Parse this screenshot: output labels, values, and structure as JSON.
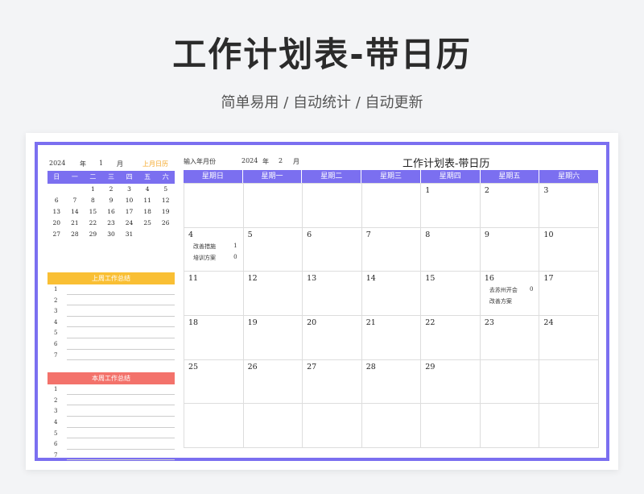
{
  "header": {
    "title": "工作计划表-带日历",
    "subtitle": "简单易用  /  自动统计  /  自动更新"
  },
  "mini": {
    "year": "2024",
    "year_unit": "年",
    "month": "1",
    "month_unit": "月",
    "prev_label": "上月日历",
    "weekdays": [
      "日",
      "一",
      "二",
      "三",
      "四",
      "五",
      "六"
    ],
    "days": [
      "",
      "",
      "1",
      "2",
      "3",
      "4",
      "5",
      "6",
      "7",
      "8",
      "9",
      "10",
      "11",
      "12",
      "13",
      "14",
      "15",
      "16",
      "17",
      "18",
      "19",
      "20",
      "21",
      "22",
      "23",
      "24",
      "25",
      "26",
      "27",
      "28",
      "29",
      "30",
      "31",
      "",
      "",
      ""
    ]
  },
  "last_week": {
    "label": "上周工作总结",
    "rows": [
      "1",
      "2",
      "3",
      "4",
      "5",
      "6",
      "7"
    ]
  },
  "this_week": {
    "label": "本周工作总结",
    "rows": [
      "1",
      "2",
      "3",
      "4",
      "5",
      "6",
      "7"
    ]
  },
  "calendar": {
    "input_label": "输入年月份",
    "year": "2024",
    "year_unit": "年",
    "month": "2",
    "month_unit": "月",
    "title": "工作计划表-带日历",
    "weekdays": [
      "星期日",
      "星期一",
      "星期二",
      "星期三",
      "星期四",
      "星期五",
      "星期六"
    ],
    "cells": [
      {
        "d": ""
      },
      {
        "d": ""
      },
      {
        "d": ""
      },
      {
        "d": ""
      },
      {
        "d": "1"
      },
      {
        "d": "2"
      },
      {
        "d": "3"
      },
      {
        "d": "4",
        "tasks": [
          {
            "t": "改善措施",
            "c": "1"
          },
          {
            "t": "培训方案",
            "c": "0"
          }
        ]
      },
      {
        "d": "5"
      },
      {
        "d": "6"
      },
      {
        "d": "7"
      },
      {
        "d": "8"
      },
      {
        "d": "9"
      },
      {
        "d": "10"
      },
      {
        "d": "11"
      },
      {
        "d": "12"
      },
      {
        "d": "13"
      },
      {
        "d": "14"
      },
      {
        "d": "15"
      },
      {
        "d": "16",
        "tasks": [
          {
            "t": "去苏州开会",
            "c": "0"
          },
          {
            "t": "改善方案",
            "c": ""
          }
        ]
      },
      {
        "d": "17"
      },
      {
        "d": "18"
      },
      {
        "d": "19"
      },
      {
        "d": "20"
      },
      {
        "d": "21"
      },
      {
        "d": "22"
      },
      {
        "d": "23"
      },
      {
        "d": "24"
      },
      {
        "d": "25"
      },
      {
        "d": "26"
      },
      {
        "d": "27"
      },
      {
        "d": "28"
      },
      {
        "d": "29"
      },
      {
        "d": ""
      },
      {
        "d": ""
      },
      {
        "d": ""
      },
      {
        "d": ""
      },
      {
        "d": ""
      },
      {
        "d": ""
      },
      {
        "d": ""
      },
      {
        "d": ""
      },
      {
        "d": ""
      }
    ]
  },
  "colors": {
    "accent": "#7b6ff0",
    "last_week": "#f9bf34",
    "this_week": "#f3726b",
    "prev_month": "#f5a623"
  }
}
